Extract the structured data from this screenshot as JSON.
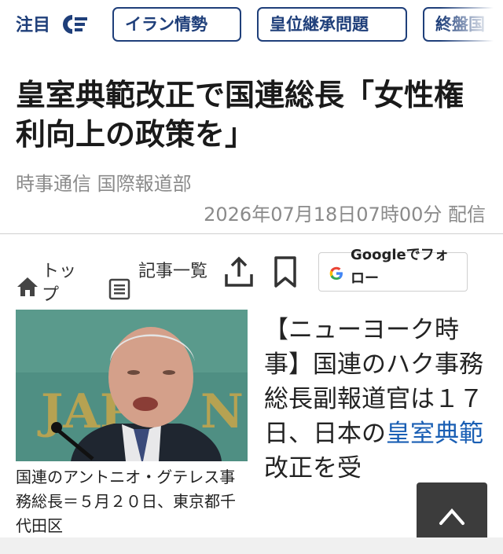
{
  "tagbar": {
    "attention_label": "注目",
    "attention_icon": "trend-logo-icon",
    "tags": [
      "イラン情勢",
      "皇位継承問題",
      "終盤国"
    ]
  },
  "article": {
    "headline": "皇室典範改正で国連総長「女性権利向上の政策を」",
    "source": "時事通信 国際報道部",
    "dateline": "2026年07月18日07時00分 配信",
    "body_lead": "【ニューヨーク時事】国連のハク事務総長副報道官は１７日、日本の",
    "body_link": "皇室典範",
    "body_rest": "改正を受",
    "caption": "国連のアントニオ・グテレス事務総長＝５月２０日、東京都千代田区"
  },
  "actions": {
    "top_label": "トップ",
    "list_label": "記事一覧",
    "google_follow_label": "Googleでフォロー",
    "icons": [
      "home-icon",
      "list-icon",
      "share-icon",
      "bookmark-icon",
      "google-g-icon",
      "chevron-up-icon"
    ]
  },
  "colors": {
    "accent_navy": "#1f3f7a",
    "link_blue": "#1a5fb4",
    "muted_gray": "#8a8a8a",
    "back_to_top_bg": "#3c3c3c"
  }
}
